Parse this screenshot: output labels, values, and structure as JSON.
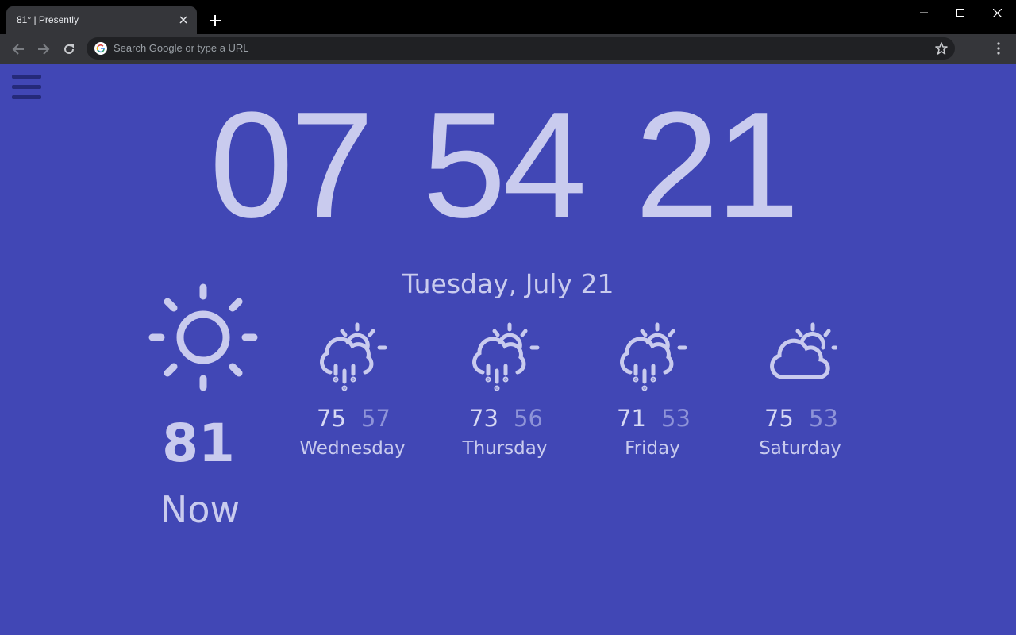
{
  "browser": {
    "tab_title": "81° | Presently",
    "omnibox_placeholder": "Search Google or type a URL"
  },
  "clock": {
    "hours": "07",
    "minutes": "54",
    "seconds": "21"
  },
  "date": "Tuesday, July 21",
  "current": {
    "temp": "81",
    "label": "Now",
    "icon": "sun-icon"
  },
  "forecast": [
    {
      "day": "Wednesday",
      "high": "75",
      "low": "57",
      "icon": "rain-partly-sunny-icon"
    },
    {
      "day": "Thursday",
      "high": "73",
      "low": "56",
      "icon": "rain-partly-sunny-icon"
    },
    {
      "day": "Friday",
      "high": "71",
      "low": "53",
      "icon": "rain-partly-sunny-icon"
    },
    {
      "day": "Saturday",
      "high": "75",
      "low": "53",
      "icon": "partly-cloudy-icon"
    }
  ],
  "colors": {
    "page_bg": "#4147b5",
    "text": "#c9cbee",
    "low_temp": "#8e93d8",
    "menu": "#252a7a"
  }
}
